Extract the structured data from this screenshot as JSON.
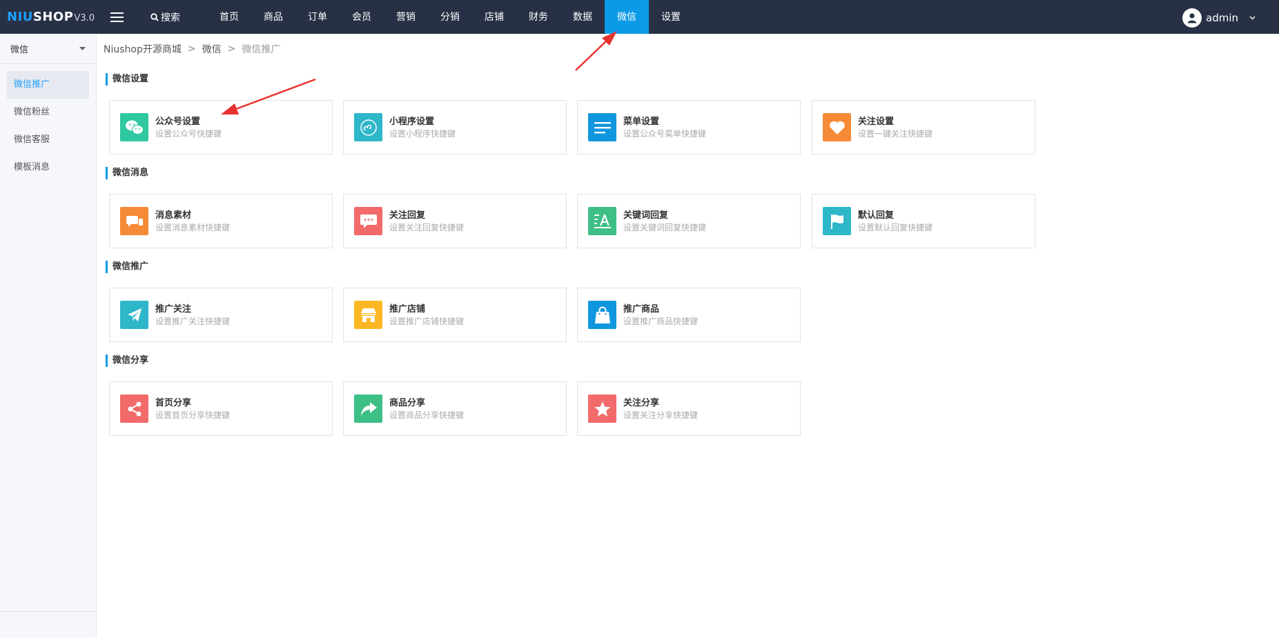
{
  "header": {
    "logo": {
      "part1": "NIU",
      "part2": "SHOP",
      "version": "V3.0"
    },
    "search_label": "搜索",
    "nav": [
      {
        "label": "首页"
      },
      {
        "label": "商品"
      },
      {
        "label": "订单"
      },
      {
        "label": "会员"
      },
      {
        "label": "营销"
      },
      {
        "label": "分销"
      },
      {
        "label": "店铺"
      },
      {
        "label": "财务"
      },
      {
        "label": "数据"
      },
      {
        "label": "微信",
        "active": true
      },
      {
        "label": "设置"
      }
    ],
    "user": "admin"
  },
  "sidebar": {
    "select_value": "微信",
    "items": [
      {
        "label": "微信推广",
        "active": true
      },
      {
        "label": "微信粉丝"
      },
      {
        "label": "微信客服"
      },
      {
        "label": "模板消息"
      }
    ]
  },
  "breadcrumb": {
    "home": "Niushop开源商城",
    "parent": "微信",
    "current": "微信推广"
  },
  "sections": [
    {
      "title": "微信设置",
      "cards": [
        {
          "title": "公众号设置",
          "subtitle": "设置公众号快捷键",
          "icon": "wechat-icon",
          "color": "#2fc8a0"
        },
        {
          "title": "小程序设置",
          "subtitle": "设置小程序快捷键",
          "icon": "miniprogram-icon",
          "color": "#2eb6c9"
        },
        {
          "title": "菜单设置",
          "subtitle": "设置公众号菜单快捷键",
          "icon": "menu-lines-icon",
          "color": "#1096de"
        },
        {
          "title": "关注设置",
          "subtitle": "设置一键关注快捷键",
          "icon": "heart-icon",
          "color": "#f68a36"
        }
      ]
    },
    {
      "title": "微信消息",
      "cards": [
        {
          "title": "消息素材",
          "subtitle": "设置消息素材快捷键",
          "icon": "chat-bubbles-icon",
          "color": "#f68a36"
        },
        {
          "title": "关注回复",
          "subtitle": "设置关注回复快捷键",
          "icon": "message-dots-icon",
          "color": "#f26a6a"
        },
        {
          "title": "关键词回复",
          "subtitle": "设置关键词回复快捷键",
          "icon": "keyword-icon",
          "color": "#3dbf86"
        },
        {
          "title": "默认回复",
          "subtitle": "设置默认回复快捷键",
          "icon": "flag-icon",
          "color": "#2eb6c9"
        }
      ]
    },
    {
      "title": "微信推广",
      "cards": [
        {
          "title": "推广关注",
          "subtitle": "设置推广关注快捷键",
          "icon": "paper-plane-icon",
          "color": "#2eb6c9"
        },
        {
          "title": "推广店铺",
          "subtitle": "设置推广店铺快捷键",
          "icon": "store-icon",
          "color": "#fcb824"
        },
        {
          "title": "推广商品",
          "subtitle": "设置推广商品快捷键",
          "icon": "shopping-bag-icon",
          "color": "#1096de"
        }
      ]
    },
    {
      "title": "微信分享",
      "cards": [
        {
          "title": "首页分享",
          "subtitle": "设置首页分享快捷键",
          "icon": "share-icon",
          "color": "#f26a6a"
        },
        {
          "title": "商品分享",
          "subtitle": "设置商品分享快捷键",
          "icon": "forward-arrow-icon",
          "color": "#3dbf86"
        },
        {
          "title": "关注分享",
          "subtitle": "设置关注分享快捷键",
          "icon": "star-icon",
          "color": "#f26a6a"
        }
      ]
    }
  ],
  "colors": {
    "topbar": "#273044",
    "accent": "#0b9ae6",
    "annotation_arrow": "#e8322f"
  }
}
